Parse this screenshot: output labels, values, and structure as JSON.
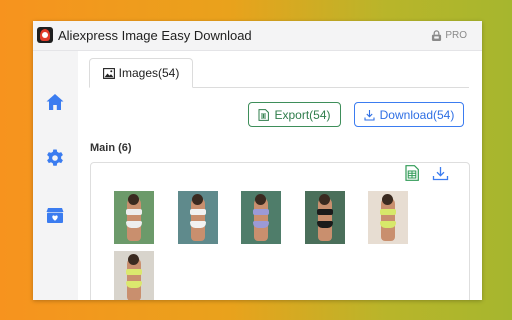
{
  "app": {
    "title": "Aliexpress Image Easy Download",
    "pro_label": "PRO"
  },
  "sidebar": {
    "items": [
      {
        "icon": "home-icon",
        "active": true
      },
      {
        "icon": "gear-icon",
        "active": false
      },
      {
        "icon": "box-heart-icon",
        "active": false
      }
    ]
  },
  "tabs": [
    {
      "label": "Images(54)",
      "icon": "image-icon",
      "active": true
    }
  ],
  "actions": {
    "export_label": "Export(54)",
    "download_label": "Download(54)"
  },
  "section": {
    "title": "Main (6)",
    "thumbnails": [
      {
        "bg": "#6c9a6a",
        "top": "#eeeeee",
        "bottom": "#eeeeee"
      },
      {
        "bg": "#5f8a8c",
        "top": "#f2f2f2",
        "bottom": "#f2f2f2"
      },
      {
        "bg": "#4f7d6a",
        "top": "#9c9ad6",
        "bottom": "#9c9ad6"
      },
      {
        "bg": "#4a6f5a",
        "top": "#1b1b1b",
        "bottom": "#1b1b1b"
      },
      {
        "bg": "#e7ddd2",
        "top": "#d7e86a",
        "bottom": "#d7e86a"
      },
      {
        "bg": "#d8d4cc",
        "top": "#dbe86e",
        "bottom": "#dbe86e"
      }
    ]
  },
  "colors": {
    "accent_blue": "#3b7cf0",
    "accent_green": "#3e8e5a"
  }
}
